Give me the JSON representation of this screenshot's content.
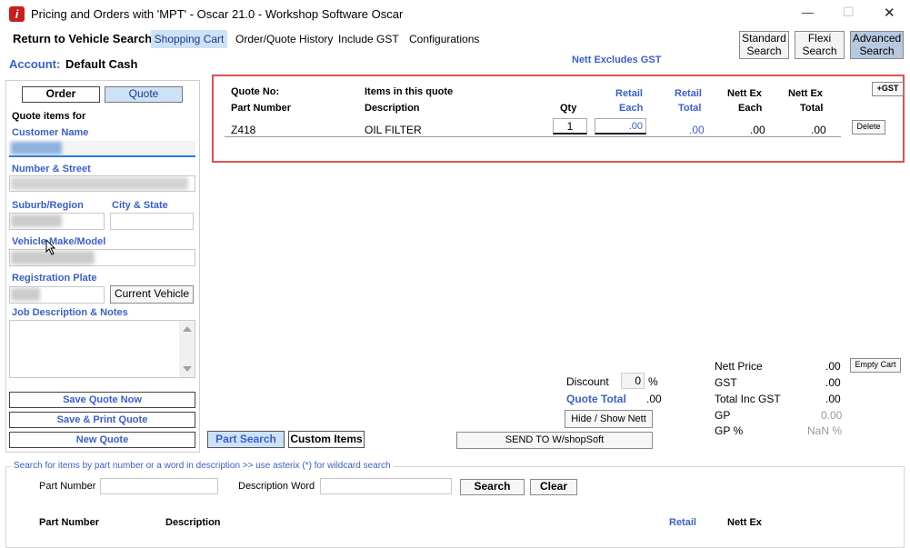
{
  "window": {
    "title": "Pricing and Orders with 'MPT' - Oscar 21.0 - Workshop Software Oscar",
    "minimize": "—",
    "maximize": "☐",
    "close": "✕"
  },
  "menu": {
    "return": "Return to Vehicle Search",
    "shopping_cart": "Shopping Cart",
    "order_history": "Order/Quote History",
    "include_gst": "Include GST",
    "configurations": "Configurations"
  },
  "search_buttons": {
    "standard_line1": "Standard",
    "standard_line2": "Search",
    "flexi_line1": "Flexi",
    "flexi_line2": "Search",
    "advanced_line1": "Advanced",
    "advanced_line2": "Search"
  },
  "account": {
    "label": "Account:",
    "value": "Default Cash"
  },
  "nett_excludes": "Nett Excludes GST",
  "left_panel": {
    "order_tab": "Order",
    "quote_tab": "Quote",
    "quote_items_for": "Quote items for",
    "customer_name": "Customer Name",
    "number_street": "Number & Street",
    "suburb_region": "Suburb/Region",
    "city_state": "City & State",
    "vehicle_make_model": "Vehicle Make/Model",
    "registration_plate": "Registration Plate",
    "current_vehicle": "Current Vehicle",
    "job_description": "Job Description & Notes",
    "save_quote_now": "Save Quote Now",
    "save_print_quote": "Save & Print Quote",
    "new_quote": "New Quote"
  },
  "quote_table": {
    "quote_no": "Quote No:",
    "items_in_quote": "Items in this quote",
    "plus_gst": "+GST",
    "headers": {
      "part_number": "Part Number",
      "description": "Description",
      "qty": "Qty",
      "retail_each_1": "Retail",
      "retail_each_2": "Each",
      "retail_total_1": "Retail",
      "retail_total_2": "Total",
      "nett_each_1": "Nett Ex",
      "nett_each_2": "Each",
      "nett_total_1": "Nett Ex",
      "nett_total_2": "Total"
    },
    "rows": [
      {
        "part_number": "Z418",
        "description": "OIL FILTER",
        "qty": "1",
        "retail_each": ".00",
        "retail_total": ".00",
        "nett_each": ".00",
        "nett_total": ".00",
        "delete": "Delete"
      }
    ]
  },
  "totals": {
    "discount_label": "Discount",
    "discount_value": "0",
    "percent": "%",
    "quote_total_label": "Quote Total",
    "quote_total_value": ".00",
    "hide_show_nett": "Hide / Show Nett",
    "send_to": "SEND TO W/shopSoft",
    "nett_price_label": "Nett Price",
    "nett_price_value": ".00",
    "gst_label": "GST",
    "gst_value": ".00",
    "total_inc_gst_label": "Total Inc GST",
    "total_inc_gst_value": ".00",
    "gp_label": "GP",
    "gp_value": "0.00",
    "gp_pct_label": "GP %",
    "gp_pct_value": "NaN %",
    "empty_cart": "Empty Cart"
  },
  "bottom_tabs": {
    "part_search": "Part Search",
    "custom_items": "Custom Items"
  },
  "search_panel": {
    "legend": "Search for items by part number or a word in description >> use asterix (*) for wildcard search",
    "part_number_label": "Part Number",
    "description_word_label": "Description Word",
    "search_button": "Search",
    "clear_button": "Clear",
    "results_headers": {
      "part_number": "Part Number",
      "description": "Description",
      "retail": "Retail",
      "nett_ex": "Nett Ex"
    }
  },
  "colors": {
    "accent_blue": "#3a5fcd",
    "highlight_border": "#e05050",
    "active_tab": "#cde2f7"
  }
}
